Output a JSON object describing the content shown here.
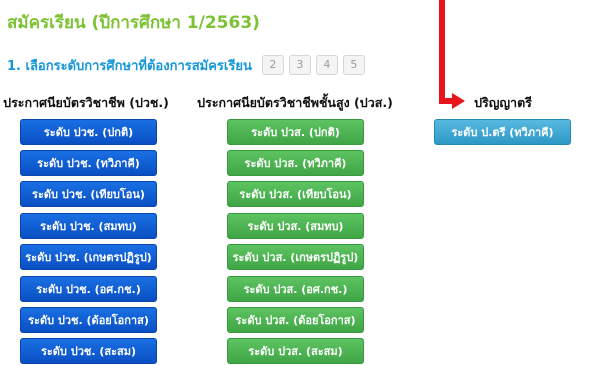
{
  "page_title": "สมัครเรียน (ปีการศึกษา 1/2563)",
  "step": {
    "label": "1. เลือกระดับการศึกษาที่ต้องการสมัครเรียน",
    "pages": [
      "2",
      "3",
      "4",
      "5"
    ]
  },
  "columns": [
    {
      "header": "ประกาศนียบัตรวิชาชีพ (ปวช.)",
      "items": [
        "ระดับ ปวช. (ปกติ)",
        "ระดับ ปวช. (ทวิภาคี)",
        "ระดับ ปวช. (เทียบโอน)",
        "ระดับ ปวช. (สมทบ)",
        "ระดับ ปวช. (เกษตรปฏิรูป)",
        "ระดับ ปวช. (อศ.กช.)",
        "ระดับ ปวช. (ด้อยโอกาส)",
        "ระดับ ปวช. (สะสม)"
      ]
    },
    {
      "header": "ประกาศนียบัตรวิชาชีพชั้นสูง (ปวส.)",
      "items": [
        "ระดับ ปวส. (ปกติ)",
        "ระดับ ปวส. (ทวิภาคี)",
        "ระดับ ปวส. (เทียบโอน)",
        "ระดับ ปวส. (สมทบ)",
        "ระดับ ปวส. (เกษตรปฏิรูป)",
        "ระดับ ปวส. (อศ.กช.)",
        "ระดับ ปวส. (ด้อยโอกาส)",
        "ระดับ ปวส. (สะสม)"
      ]
    },
    {
      "header": "ปริญญาตรี",
      "items": [
        "ระดับ ป.ตรี (ทวิภาคี)"
      ]
    }
  ],
  "colors": {
    "title": "#7cc234",
    "step_label": "#1597d8",
    "col1_button": "#0a4fc4",
    "col2_button": "#3fa545",
    "col3_button": "#2d98c6",
    "arrow": "#e8141b"
  }
}
